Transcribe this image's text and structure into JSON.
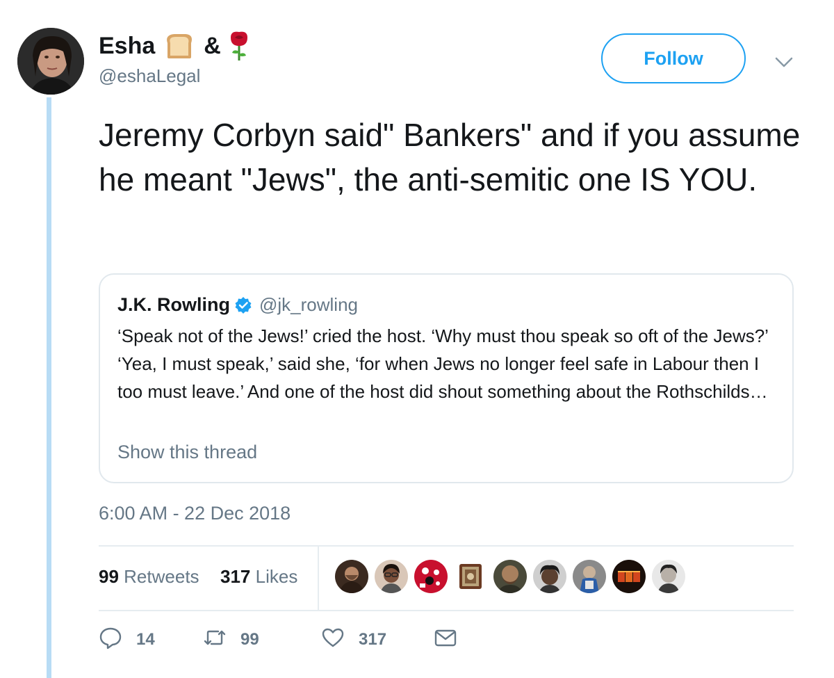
{
  "author": {
    "display_name": "Esha",
    "separator": "&",
    "handle": "@eshaLegal",
    "emoji_1": "bread-emoji",
    "emoji_2": "rose-emoji"
  },
  "follow_label": "Follow",
  "tweet_text": "Jeremy Corbyn said\" Bankers\" and if you assume he meant \"Jews\", the anti-semitic one IS YOU.",
  "quoted": {
    "name": "J.K. Rowling",
    "handle": "@jk_rowling",
    "verified": true,
    "text": "‘Speak not of the Jews!’ cried the host. ‘Why must thou speak so oft of the Jews?’ ‘Yea, I must speak,’ said she, ‘for when Jews no longer feel safe in Labour then I too must leave.’ And one of the host did shout something about the Rothschilds…",
    "show_thread": "Show this thread"
  },
  "timestamp": "6:00 AM - 22 Dec 2018",
  "stats": {
    "retweets_count": "99",
    "retweets_label": "Retweets",
    "likes_count": "317",
    "likes_label": "Likes"
  },
  "likers_count_shown": 9,
  "actions": {
    "reply_count": "14",
    "retweet_count": "99",
    "like_count": "317"
  },
  "colors": {
    "accent": "#1da1f2",
    "muted": "#657786",
    "thread_line": "#b8dcf5",
    "border": "#e1e8ed"
  }
}
